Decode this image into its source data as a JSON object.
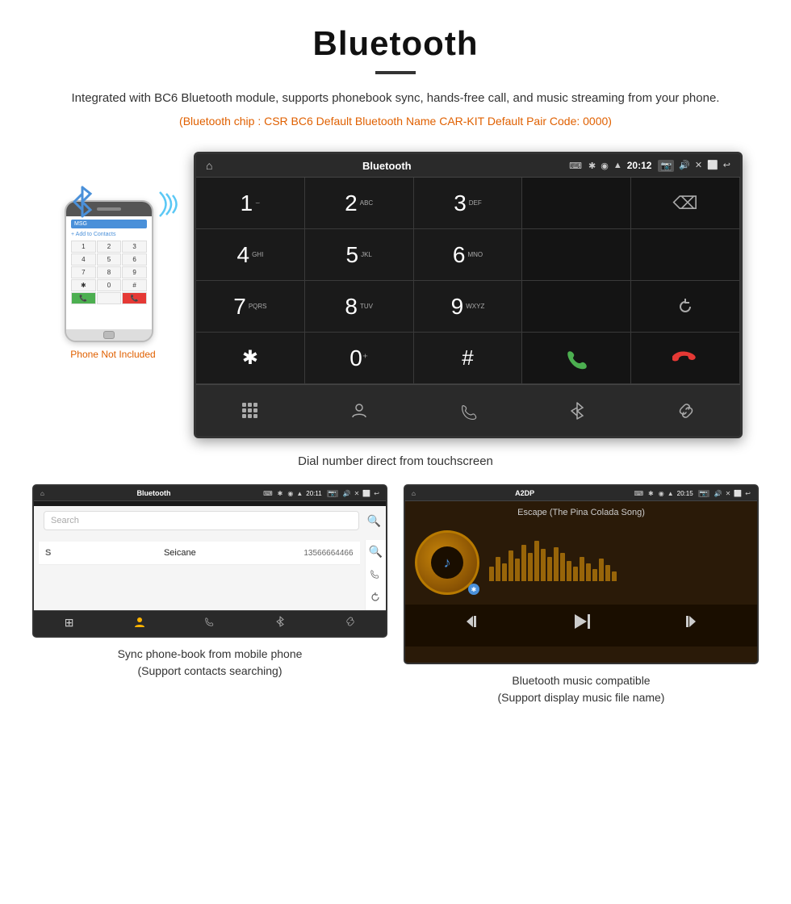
{
  "header": {
    "title": "Bluetooth",
    "description": "Integrated with BC6 Bluetooth module, supports phonebook sync, hands-free call, and music streaming from your phone.",
    "specs": "(Bluetooth chip : CSR BC6    Default Bluetooth Name CAR-KIT    Default Pair Code: 0000)"
  },
  "phone_area": {
    "not_included_label": "Phone Not Included"
  },
  "car_screen": {
    "status_bar": {
      "title": "Bluetooth",
      "usb_icon": "⌨",
      "bt_icon": "✱",
      "location_icon": "◉",
      "wifi_icon": "▲",
      "time": "20:12",
      "camera_icon": "📷",
      "volume_icon": "🔊",
      "close_icon": "✕",
      "window_icon": "⬜",
      "back_icon": "↩"
    },
    "dialpad": {
      "keys": [
        {
          "number": "1",
          "sub": "⌣"
        },
        {
          "number": "2",
          "sub": "ABC"
        },
        {
          "number": "3",
          "sub": "DEF"
        },
        {
          "number": "",
          "sub": ""
        },
        {
          "number": "⌫",
          "sub": ""
        },
        {
          "number": "4",
          "sub": "GHI"
        },
        {
          "number": "5",
          "sub": "JKL"
        },
        {
          "number": "6",
          "sub": "MNO"
        },
        {
          "number": "",
          "sub": ""
        },
        {
          "number": "",
          "sub": ""
        },
        {
          "number": "7",
          "sub": "PQRS"
        },
        {
          "number": "8",
          "sub": "TUV"
        },
        {
          "number": "9",
          "sub": "WXYZ"
        },
        {
          "number": "",
          "sub": ""
        },
        {
          "number": "↺",
          "sub": ""
        },
        {
          "number": "✱",
          "sub": ""
        },
        {
          "number": "0⁺",
          "sub": ""
        },
        {
          "number": "#",
          "sub": ""
        },
        {
          "number": "☎",
          "sub": "green"
        },
        {
          "number": "☎",
          "sub": "red"
        }
      ]
    },
    "bottom_nav": {
      "items": [
        "⊞",
        "👤",
        "☎",
        "✱",
        "🔗"
      ]
    }
  },
  "dial_caption": "Dial number direct from touchscreen",
  "phonebook_screen": {
    "status_title": "Bluetooth",
    "time": "20:11",
    "search_placeholder": "Search",
    "contact": {
      "letter": "S",
      "name": "Seicane",
      "number": "13566664466"
    },
    "bottom_nav": [
      "⊞",
      "👤",
      "☎",
      "✱",
      "🔗"
    ]
  },
  "phonebook_caption": {
    "line1": "Sync phone-book from mobile phone",
    "line2": "(Support contacts searching)"
  },
  "music_screen": {
    "status_title": "A2DP",
    "time": "20:15",
    "song_title": "Escape (The Pina Colada Song)",
    "controls": [
      "⏮",
      "⏭⏸",
      "⏭"
    ]
  },
  "music_caption": {
    "line1": "Bluetooth music compatible",
    "line2": "(Support display music file name)"
  }
}
